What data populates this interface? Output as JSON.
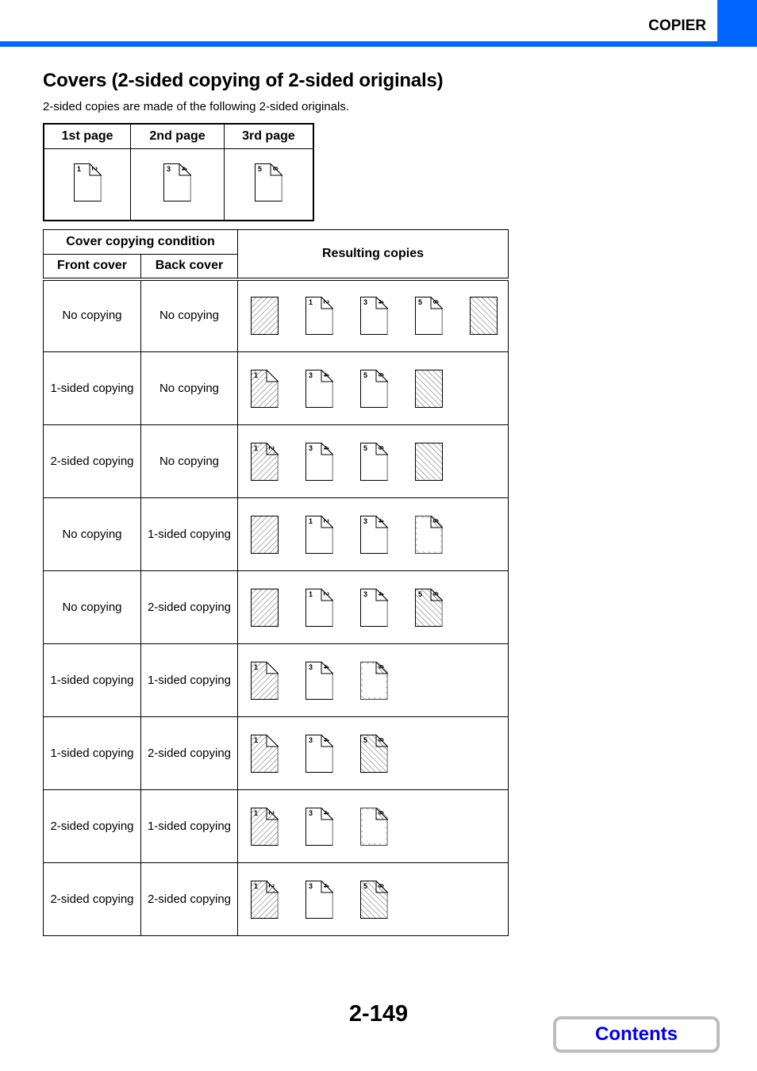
{
  "header": {
    "section": "COPIER",
    "accent_color": "#0066ff"
  },
  "title": "Covers (2-sided copying of 2-sided originals)",
  "intro": "2-sided copies are made of the following 2-sided originals.",
  "originals": {
    "headers": [
      "1st page",
      "2nd page",
      "3rd page"
    ],
    "pages": [
      {
        "type": "sheet",
        "front": "1",
        "back": "2"
      },
      {
        "type": "sheet",
        "front": "3",
        "back": "4"
      },
      {
        "type": "sheet",
        "front": "5",
        "back": "6"
      }
    ]
  },
  "table": {
    "group_header": "Cover copying condition",
    "front_header": "Front cover",
    "back_header": "Back cover",
    "result_header": "Resulting copies",
    "rows": [
      {
        "front": "No copying",
        "back": "No copying",
        "copies": [
          {
            "type": "front-cover-blank"
          },
          {
            "type": "sheet",
            "front": "1",
            "back": "2"
          },
          {
            "type": "sheet",
            "front": "3",
            "back": "4"
          },
          {
            "type": "sheet",
            "front": "5",
            "back": "6"
          },
          {
            "type": "back-cover-blank"
          }
        ]
      },
      {
        "front": "1-sided copying",
        "back": "No copying",
        "copies": [
          {
            "type": "front-cover-1sided",
            "front": "1",
            "back": ""
          },
          {
            "type": "sheet",
            "front": "3",
            "back": "4"
          },
          {
            "type": "sheet",
            "front": "5",
            "back": "6"
          },
          {
            "type": "back-cover-blank"
          }
        ]
      },
      {
        "front": "2-sided copying",
        "back": "No copying",
        "copies": [
          {
            "type": "front-cover-2sided",
            "front": "1",
            "back": "2"
          },
          {
            "type": "sheet",
            "front": "3",
            "back": "4"
          },
          {
            "type": "sheet",
            "front": "5",
            "back": "6"
          },
          {
            "type": "back-cover-blank"
          }
        ]
      },
      {
        "front": "No copying",
        "back": "1-sided copying",
        "copies": [
          {
            "type": "front-cover-blank"
          },
          {
            "type": "sheet",
            "front": "1",
            "back": "2"
          },
          {
            "type": "sheet",
            "front": "3",
            "back": "4"
          },
          {
            "type": "back-cover-1sided",
            "front": "",
            "back": "6"
          }
        ]
      },
      {
        "front": "No copying",
        "back": "2-sided copying",
        "copies": [
          {
            "type": "front-cover-blank"
          },
          {
            "type": "sheet",
            "front": "1",
            "back": "2"
          },
          {
            "type": "sheet",
            "front": "3",
            "back": "4"
          },
          {
            "type": "back-cover-2sided",
            "front": "5",
            "back": "6"
          }
        ]
      },
      {
        "front": "1-sided copying",
        "back": "1-sided copying",
        "copies": [
          {
            "type": "front-cover-1sided",
            "front": "1",
            "back": ""
          },
          {
            "type": "sheet",
            "front": "3",
            "back": "4"
          },
          {
            "type": "back-cover-1sided",
            "front": "",
            "back": "6"
          }
        ]
      },
      {
        "front": "1-sided copying",
        "back": "2-sided copying",
        "copies": [
          {
            "type": "front-cover-1sided",
            "front": "1",
            "back": ""
          },
          {
            "type": "sheet",
            "front": "3",
            "back": "4"
          },
          {
            "type": "back-cover-2sided",
            "front": "5",
            "back": "6"
          }
        ]
      },
      {
        "front": "2-sided copying",
        "back": "1-sided copying",
        "copies": [
          {
            "type": "front-cover-2sided",
            "front": "1",
            "back": "2"
          },
          {
            "type": "sheet",
            "front": "3",
            "back": "4"
          },
          {
            "type": "back-cover-1sided",
            "front": "",
            "back": "6"
          }
        ]
      },
      {
        "front": "2-sided copying",
        "back": "2-sided copying",
        "copies": [
          {
            "type": "front-cover-2sided",
            "front": "1",
            "back": "2"
          },
          {
            "type": "sheet",
            "front": "3",
            "back": "4"
          },
          {
            "type": "back-cover-2sided",
            "front": "5",
            "back": "6"
          }
        ]
      }
    ]
  },
  "footer": {
    "page_number": "2-149",
    "contents_label": "Contents",
    "contents_color": "#0000ee"
  }
}
